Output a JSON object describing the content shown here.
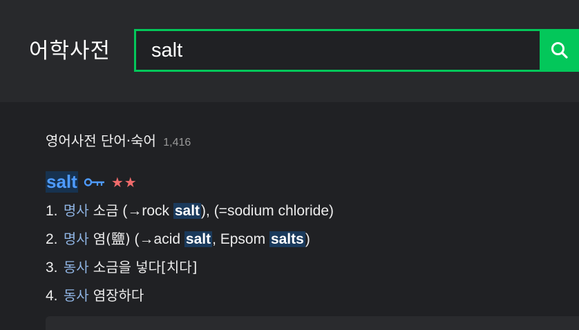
{
  "header": {
    "brand": "어학사전",
    "search_value": "salt"
  },
  "section": {
    "title": "영어사전 단어·숙어",
    "count": "1,416"
  },
  "entry": {
    "word": "salt",
    "stars": "★★",
    "definitions": [
      {
        "num": "1.",
        "pos": "명사",
        "meaning": "소금",
        "ex_open": " (→rock ",
        "ex_hl": "salt",
        "ex_close": "), (=sodium chloride)"
      },
      {
        "num": "2.",
        "pos": "명사",
        "meaning": "염(鹽)",
        "ex_open": " (→acid ",
        "ex_hl": "salt",
        "ex_mid": ", Epsom ",
        "ex_hl2": "salts",
        "ex_close": ")"
      },
      {
        "num": "3.",
        "pos": "동사",
        "meaning": "소금을 넣다[치다]"
      },
      {
        "num": "4.",
        "pos": "동사",
        "meaning": "염장하다"
      }
    ]
  },
  "colors": {
    "accent": "#03c75a",
    "link": "#4e9bff",
    "star": "#f06b6b"
  },
  "icons": {
    "search": "search-icon",
    "pronunciation": "key-icon"
  }
}
